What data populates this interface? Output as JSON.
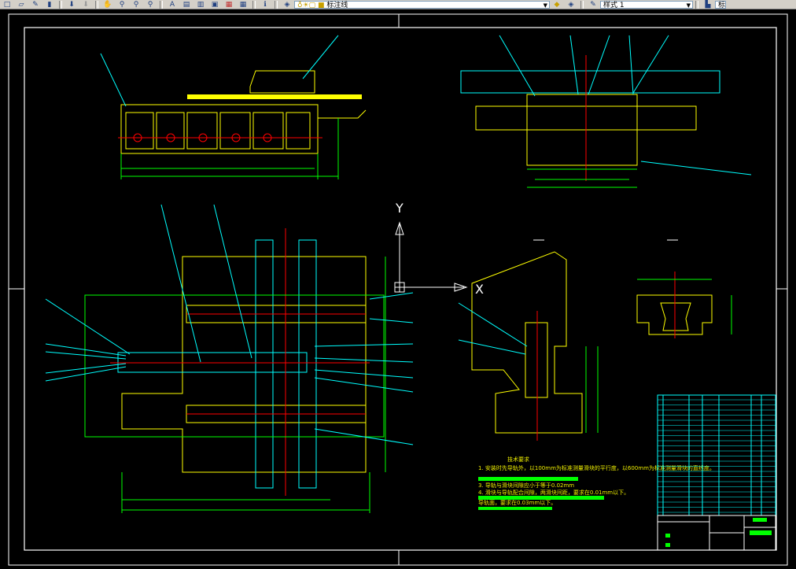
{
  "toolbar": {
    "layer_combo": "标注线",
    "style_combo": "样式 1",
    "right_combo": "标"
  },
  "drawing": {
    "axis_x": "X",
    "axis_y": "Y",
    "notes_title": "技术要求",
    "notes": [
      "1. 安装时先导轨外，以100mm为标准测量滑块的平行度，以600mm为标准测量滑块的直线度。",
      "3. 导轨与滑块间隙应小于等于0.02mm",
      "4. 滑块与导轨配合间隙，两滑块间距，要求在0.01mm以下。",
      "导轨面，要求在0.03mm以下。"
    ]
  },
  "colors": {
    "background": "#000000",
    "frame": "#ffffff",
    "part": "#ffff00",
    "centerline": "#ff0000",
    "dimension": "#00ff00",
    "leader": "#00ffff",
    "highlight": "#00ff00"
  }
}
